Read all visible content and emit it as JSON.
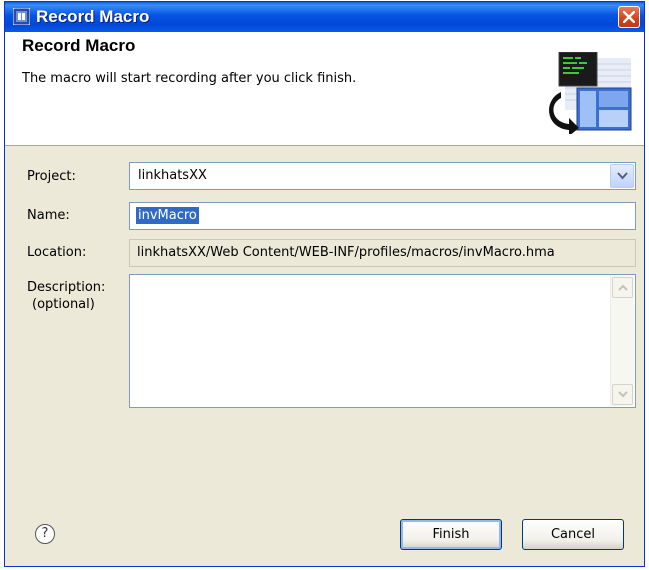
{
  "window": {
    "title": "Record Macro",
    "close_label": "Close"
  },
  "header": {
    "title": "Record Macro",
    "description": "The macro will start recording after you click finish."
  },
  "form": {
    "project_label": "Project:",
    "project_value": "linkhatsXX",
    "name_label": "Name:",
    "name_value": "invMacro",
    "location_label": "Location:",
    "location_value": "linkhatsXX/Web Content/WEB-INF/profiles/macros/invMacro.hma",
    "description_label": "Description:",
    "description_optional": "(optional)",
    "description_value": ""
  },
  "footer": {
    "help_glyph": "?",
    "finish_label": "Finish",
    "cancel_label": "Cancel"
  },
  "icons": {
    "title_icon": "macro-app-icon",
    "header_graphic": "record-macro-wizard-graphic",
    "combo_arrow": "chevron-down-icon",
    "help": "help-icon",
    "close": "close-icon"
  },
  "colors": {
    "titlebar": "#0554e3",
    "dialog_bg": "#ece9d8",
    "selection": "#316ac5",
    "close_button": "#d2421a"
  }
}
